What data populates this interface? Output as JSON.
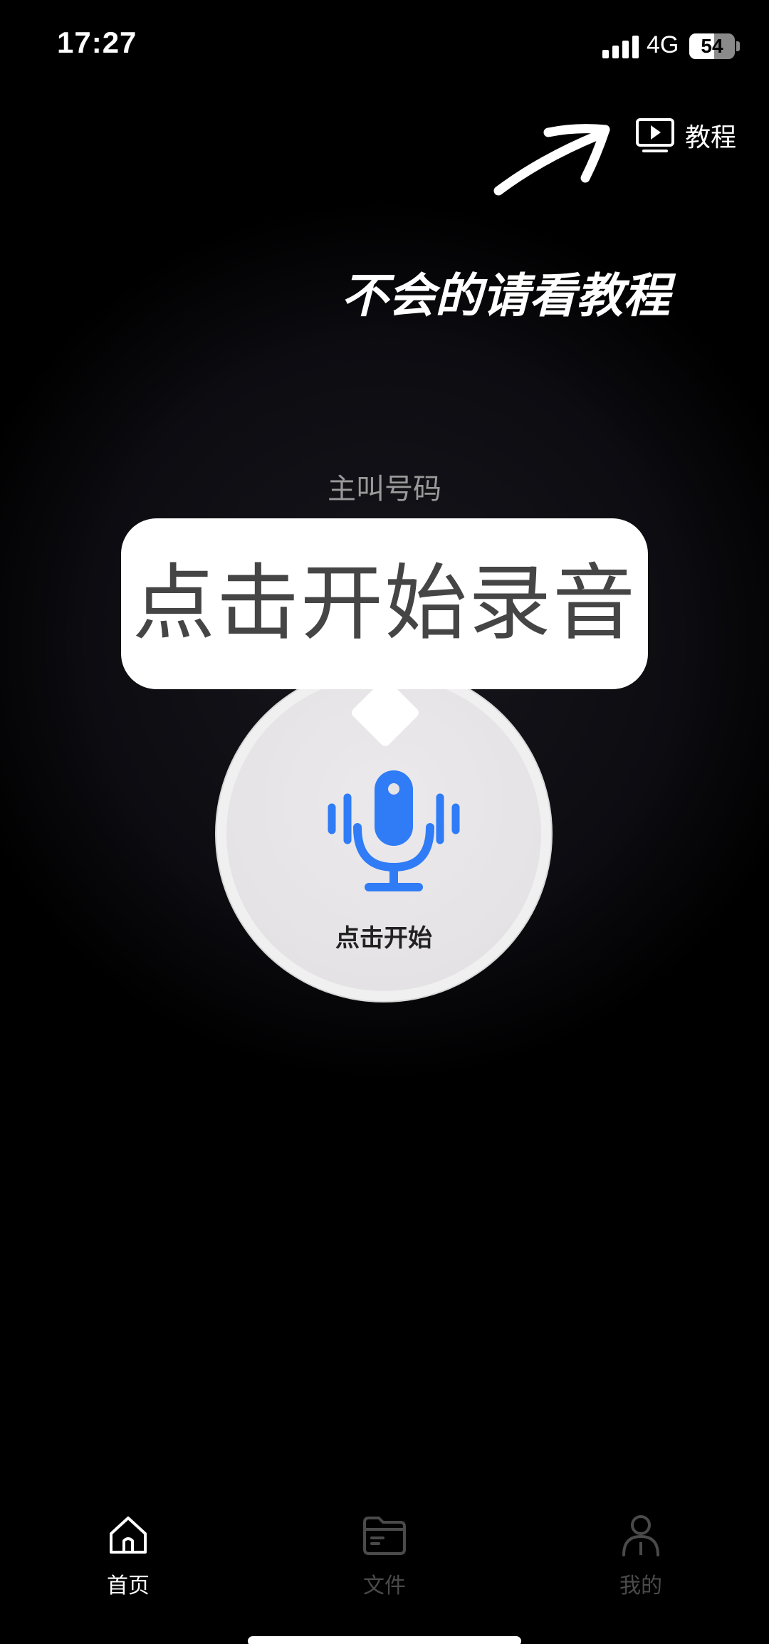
{
  "status_bar": {
    "time": "17:27",
    "network": "4G",
    "battery_percent": 54,
    "battery_label": "54"
  },
  "tutorial": {
    "label": "教程",
    "icon": "play-screen-icon"
  },
  "hint": {
    "text": "不会的请看教程"
  },
  "caller": {
    "label": "主叫号码"
  },
  "tooltip": {
    "text": "点击开始录音"
  },
  "record_button": {
    "label": "点击开始",
    "icon": "microphone-icon",
    "accent_color": "#2f7cf6"
  },
  "tabs": [
    {
      "label": "首页",
      "icon": "home-icon",
      "active": true
    },
    {
      "label": "文件",
      "icon": "folder-icon",
      "active": false
    },
    {
      "label": "我的",
      "icon": "person-icon",
      "active": false
    }
  ]
}
